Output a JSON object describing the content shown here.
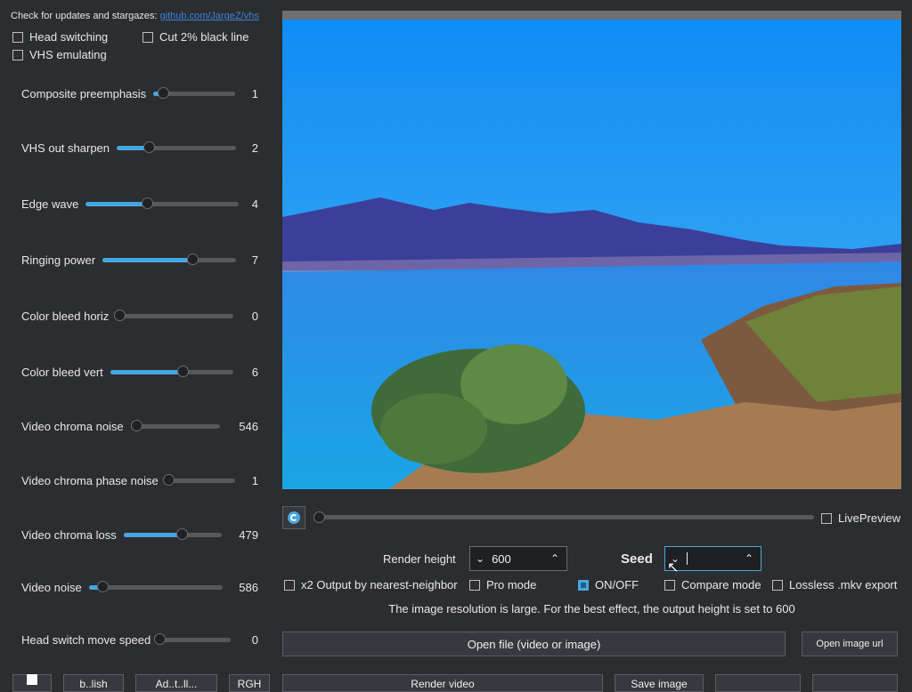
{
  "header": {
    "update_text": "Check for updates and stargazes:",
    "update_link": "github.com/JargeZ/vhs"
  },
  "options": {
    "head_switching": "Head switching",
    "cut_black_line": "Cut 2% black line",
    "vhs_emulating": "VHS emulating"
  },
  "sliders": [
    {
      "label": "Composite preemphasis",
      "value": "1",
      "fraction": 0.12
    },
    {
      "label": "VHS out sharpen",
      "value": "2",
      "fraction": 0.27
    },
    {
      "label": "Edge wave",
      "value": "4",
      "fraction": 0.4
    },
    {
      "label": "Ringing power",
      "value": "7",
      "fraction": 0.67
    },
    {
      "label": "Color bleed horiz",
      "value": "0",
      "fraction": 0.0
    },
    {
      "label": "Color bleed vert",
      "value": "6",
      "fraction": 0.59
    },
    {
      "label": "Video chroma noise",
      "value": "546",
      "fraction": 0.06
    },
    {
      "label": "Video chroma phase noise",
      "value": "1",
      "fraction": 0.02
    },
    {
      "label": "Video chroma loss",
      "value": "479",
      "fraction": 0.59
    },
    {
      "label": "Video noise",
      "value": "586",
      "fraction": 0.1
    },
    {
      "label": "Head switch move speed",
      "value": "0",
      "fraction": 0.0
    }
  ],
  "controls": {
    "live_preview": "LivePreview",
    "render_height_label": "Render height",
    "render_height_value": "600",
    "seed_label": "Seed",
    "seed_value": "",
    "x2_output": "x2 Output by nearest-neighbor",
    "pro_mode": "Pro mode",
    "on_off": "ON/OFF",
    "compare_mode": "Compare mode",
    "lossless_export": "Lossless .mkv export",
    "resolution_note": "The image resolution is large. For the best effect, the output height is set to 600",
    "open_file": "Open file (video or image)",
    "open_image_url": "Open image url"
  },
  "bottom_row": [
    "",
    "b..lish",
    "Ad..t..ll...",
    "RGH",
    "Render video",
    "Save image",
    "",
    ""
  ],
  "colors": {
    "background": "#2b2d30",
    "accent": "#46a6e0",
    "link": "#3b82d6"
  }
}
